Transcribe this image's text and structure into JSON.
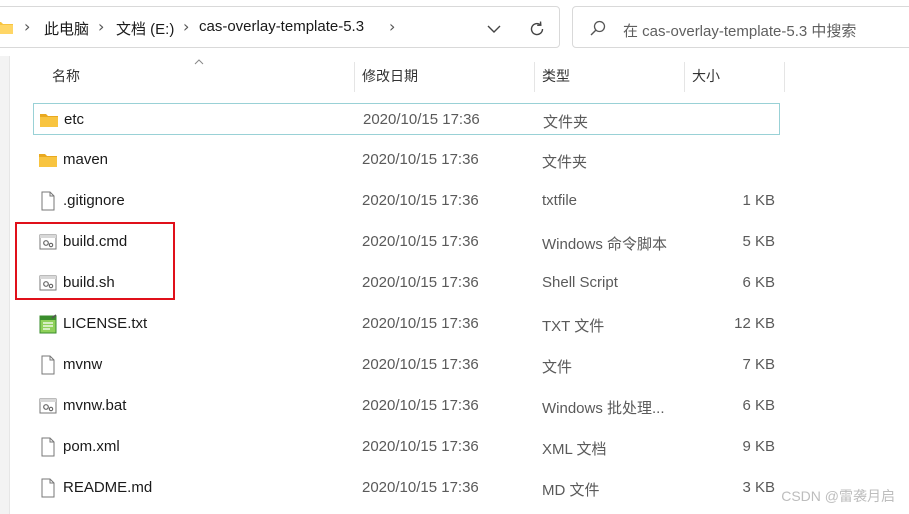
{
  "breadcrumb": {
    "items": [
      "此电脑",
      "文档 (E:)",
      "cas-overlay-template-5.3"
    ]
  },
  "search": {
    "placeholder": "在 cas-overlay-template-5.3 中搜索"
  },
  "columns": {
    "name": "名称",
    "date": "修改日期",
    "type": "类型",
    "size": "大小"
  },
  "files": [
    {
      "icon": "folder-icon",
      "name": "etc",
      "date": "2020/10/15 17:36",
      "type": "文件夹",
      "size": ""
    },
    {
      "icon": "folder-icon",
      "name": "maven",
      "date": "2020/10/15 17:36",
      "type": "文件夹",
      "size": ""
    },
    {
      "icon": "file-icon",
      "name": ".gitignore",
      "date": "2020/10/15 17:36",
      "type": "txtfile",
      "size": "1 KB"
    },
    {
      "icon": "script-icon",
      "name": "build.cmd",
      "date": "2020/10/15 17:36",
      "type": "Windows 命令脚本",
      "size": "5 KB"
    },
    {
      "icon": "script-icon",
      "name": "build.sh",
      "date": "2020/10/15 17:36",
      "type": "Shell Script",
      "size": "6 KB"
    },
    {
      "icon": "notepad-icon",
      "name": "LICENSE.txt",
      "date": "2020/10/15 17:36",
      "type": "TXT 文件",
      "size": "12 KB"
    },
    {
      "icon": "file-icon",
      "name": "mvnw",
      "date": "2020/10/15 17:36",
      "type": "文件",
      "size": "7 KB"
    },
    {
      "icon": "script-icon",
      "name": "mvnw.bat",
      "date": "2020/10/15 17:36",
      "type": "Windows 批处理...",
      "size": "6 KB"
    },
    {
      "icon": "file-icon",
      "name": "pom.xml",
      "date": "2020/10/15 17:36",
      "type": "XML 文档",
      "size": "9 KB"
    },
    {
      "icon": "file-icon",
      "name": "README.md",
      "date": "2020/10/15 17:36",
      "type": "MD 文件",
      "size": "3 KB"
    }
  ],
  "watermark": "CSDN @雷袭月启",
  "colors": {
    "folder": "#f8c440",
    "selection_border": "#99d1d6",
    "highlight": "#e0101a"
  }
}
